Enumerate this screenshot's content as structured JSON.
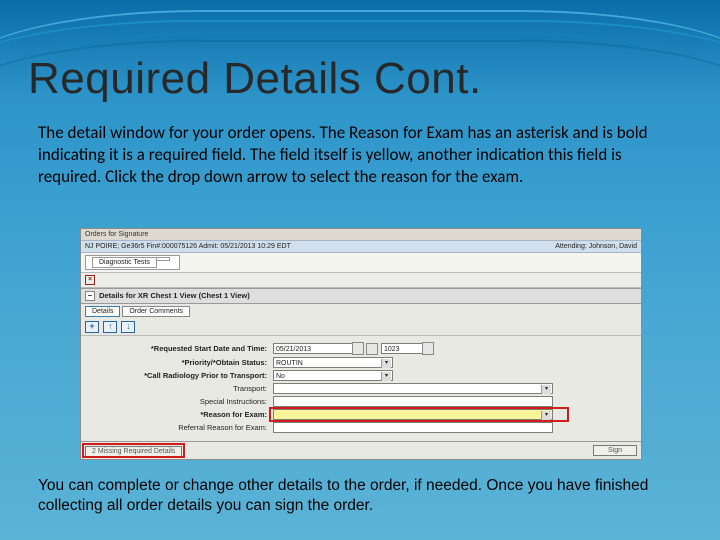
{
  "slide": {
    "title": "Required Details Cont.",
    "para_top": "The detail window for your order opens.  The Reason for Exam has an asterisk and is bold indicating it is a required field.  The field itself is yellow, another indication this field is required.  Click the drop down arrow to select the reason for the exam.",
    "para_bottom": "You can complete or change other details to the order, if needed.  Once you have finished collecting all order details you can sign the order."
  },
  "app": {
    "titlebar": "Orders for Signature",
    "patient_line_left": "NJ POIRE; Ge36r5  Fin#:000075126  Admit: 05/21/2013 10:29 EDT",
    "patient_line_right": "Attending: Johnson, David",
    "tab_label": "Diagnostic Tests",
    "toolbar_text": " ",
    "section_head_prefix": "Details for ",
    "section_head_bold": "XR Chest 1 View (Chest 1 View)",
    "tab_details": "Details",
    "tab_comments": "Order Comments",
    "form": {
      "start_label": "*Requested Start Date and Time:",
      "start_value": "05/21/2013",
      "start_time": "1023",
      "priority_label": "*Priority/*Obtain Status:",
      "priority_value": "ROUTIN",
      "pretransport_label": "*Call Radiology Prior to Transport:",
      "pretransport_value": "No",
      "transport_label": "Transport:",
      "special_label": "Special Instructions:",
      "reason_label": "*Reason for Exam:",
      "referral_label": "Referral Reason for Exam:"
    },
    "footer": {
      "missing": "2 Missing Required Details",
      "sign": "Sign"
    }
  }
}
